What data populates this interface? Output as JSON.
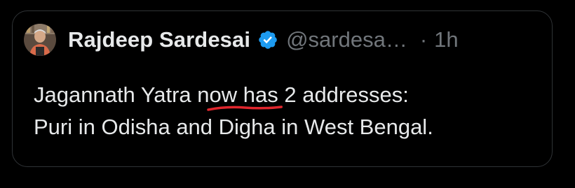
{
  "tweet": {
    "author": {
      "name": "Rajdeep Sardesai",
      "handle": "@sardesa…",
      "verified": true,
      "avatar_icon": "avatar-photo"
    },
    "separator": "·",
    "time": "1h",
    "text": {
      "line1_before": "Jagannath Yatra n",
      "line1_highlight": "ow has",
      "line1_after": " 2 addresses:",
      "line2": "Puri in Odisha and Digha in West Bengal."
    },
    "annotation": {
      "type": "hand-drawn-underline",
      "color": "#e0262d"
    }
  },
  "colors": {
    "background": "#000000",
    "text_primary": "#e7e9ea",
    "text_secondary": "#71767b",
    "border": "#2f3336",
    "verified_badge": "#1d9bf0"
  }
}
